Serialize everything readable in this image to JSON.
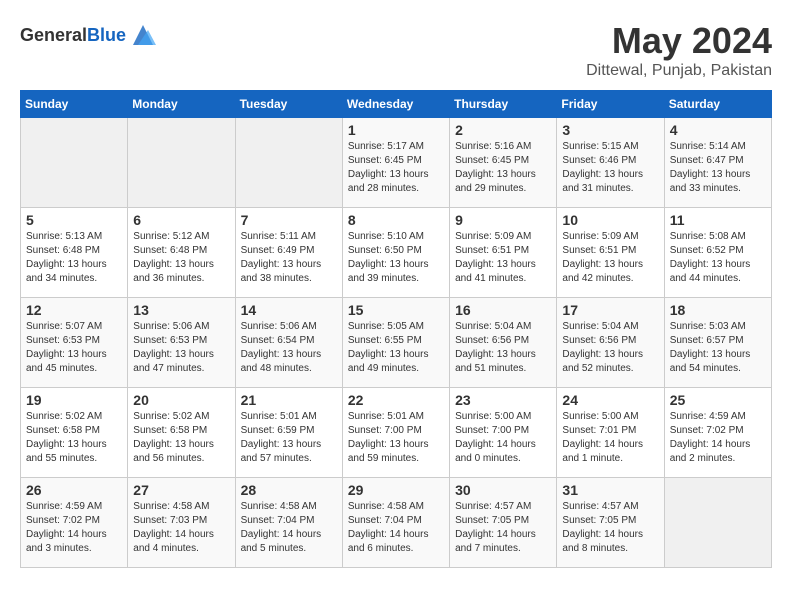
{
  "header": {
    "logo_general": "General",
    "logo_blue": "Blue",
    "title": "May 2024",
    "subtitle": "Dittewal, Punjab, Pakistan"
  },
  "calendar": {
    "columns": [
      "Sunday",
      "Monday",
      "Tuesday",
      "Wednesday",
      "Thursday",
      "Friday",
      "Saturday"
    ],
    "weeks": [
      [
        {
          "day": "",
          "info": ""
        },
        {
          "day": "",
          "info": ""
        },
        {
          "day": "",
          "info": ""
        },
        {
          "day": "1",
          "info": "Sunrise: 5:17 AM\nSunset: 6:45 PM\nDaylight: 13 hours\nand 28 minutes."
        },
        {
          "day": "2",
          "info": "Sunrise: 5:16 AM\nSunset: 6:45 PM\nDaylight: 13 hours\nand 29 minutes."
        },
        {
          "day": "3",
          "info": "Sunrise: 5:15 AM\nSunset: 6:46 PM\nDaylight: 13 hours\nand 31 minutes."
        },
        {
          "day": "4",
          "info": "Sunrise: 5:14 AM\nSunset: 6:47 PM\nDaylight: 13 hours\nand 33 minutes."
        }
      ],
      [
        {
          "day": "5",
          "info": "Sunrise: 5:13 AM\nSunset: 6:48 PM\nDaylight: 13 hours\nand 34 minutes."
        },
        {
          "day": "6",
          "info": "Sunrise: 5:12 AM\nSunset: 6:48 PM\nDaylight: 13 hours\nand 36 minutes."
        },
        {
          "day": "7",
          "info": "Sunrise: 5:11 AM\nSunset: 6:49 PM\nDaylight: 13 hours\nand 38 minutes."
        },
        {
          "day": "8",
          "info": "Sunrise: 5:10 AM\nSunset: 6:50 PM\nDaylight: 13 hours\nand 39 minutes."
        },
        {
          "day": "9",
          "info": "Sunrise: 5:09 AM\nSunset: 6:51 PM\nDaylight: 13 hours\nand 41 minutes."
        },
        {
          "day": "10",
          "info": "Sunrise: 5:09 AM\nSunset: 6:51 PM\nDaylight: 13 hours\nand 42 minutes."
        },
        {
          "day": "11",
          "info": "Sunrise: 5:08 AM\nSunset: 6:52 PM\nDaylight: 13 hours\nand 44 minutes."
        }
      ],
      [
        {
          "day": "12",
          "info": "Sunrise: 5:07 AM\nSunset: 6:53 PM\nDaylight: 13 hours\nand 45 minutes."
        },
        {
          "day": "13",
          "info": "Sunrise: 5:06 AM\nSunset: 6:53 PM\nDaylight: 13 hours\nand 47 minutes."
        },
        {
          "day": "14",
          "info": "Sunrise: 5:06 AM\nSunset: 6:54 PM\nDaylight: 13 hours\nand 48 minutes."
        },
        {
          "day": "15",
          "info": "Sunrise: 5:05 AM\nSunset: 6:55 PM\nDaylight: 13 hours\nand 49 minutes."
        },
        {
          "day": "16",
          "info": "Sunrise: 5:04 AM\nSunset: 6:56 PM\nDaylight: 13 hours\nand 51 minutes."
        },
        {
          "day": "17",
          "info": "Sunrise: 5:04 AM\nSunset: 6:56 PM\nDaylight: 13 hours\nand 52 minutes."
        },
        {
          "day": "18",
          "info": "Sunrise: 5:03 AM\nSunset: 6:57 PM\nDaylight: 13 hours\nand 54 minutes."
        }
      ],
      [
        {
          "day": "19",
          "info": "Sunrise: 5:02 AM\nSunset: 6:58 PM\nDaylight: 13 hours\nand 55 minutes."
        },
        {
          "day": "20",
          "info": "Sunrise: 5:02 AM\nSunset: 6:58 PM\nDaylight: 13 hours\nand 56 minutes."
        },
        {
          "day": "21",
          "info": "Sunrise: 5:01 AM\nSunset: 6:59 PM\nDaylight: 13 hours\nand 57 minutes."
        },
        {
          "day": "22",
          "info": "Sunrise: 5:01 AM\nSunset: 7:00 PM\nDaylight: 13 hours\nand 59 minutes."
        },
        {
          "day": "23",
          "info": "Sunrise: 5:00 AM\nSunset: 7:00 PM\nDaylight: 14 hours\nand 0 minutes."
        },
        {
          "day": "24",
          "info": "Sunrise: 5:00 AM\nSunset: 7:01 PM\nDaylight: 14 hours\nand 1 minute."
        },
        {
          "day": "25",
          "info": "Sunrise: 4:59 AM\nSunset: 7:02 PM\nDaylight: 14 hours\nand 2 minutes."
        }
      ],
      [
        {
          "day": "26",
          "info": "Sunrise: 4:59 AM\nSunset: 7:02 PM\nDaylight: 14 hours\nand 3 minutes."
        },
        {
          "day": "27",
          "info": "Sunrise: 4:58 AM\nSunset: 7:03 PM\nDaylight: 14 hours\nand 4 minutes."
        },
        {
          "day": "28",
          "info": "Sunrise: 4:58 AM\nSunset: 7:04 PM\nDaylight: 14 hours\nand 5 minutes."
        },
        {
          "day": "29",
          "info": "Sunrise: 4:58 AM\nSunset: 7:04 PM\nDaylight: 14 hours\nand 6 minutes."
        },
        {
          "day": "30",
          "info": "Sunrise: 4:57 AM\nSunset: 7:05 PM\nDaylight: 14 hours\nand 7 minutes."
        },
        {
          "day": "31",
          "info": "Sunrise: 4:57 AM\nSunset: 7:05 PM\nDaylight: 14 hours\nand 8 minutes."
        },
        {
          "day": "",
          "info": ""
        }
      ]
    ]
  }
}
